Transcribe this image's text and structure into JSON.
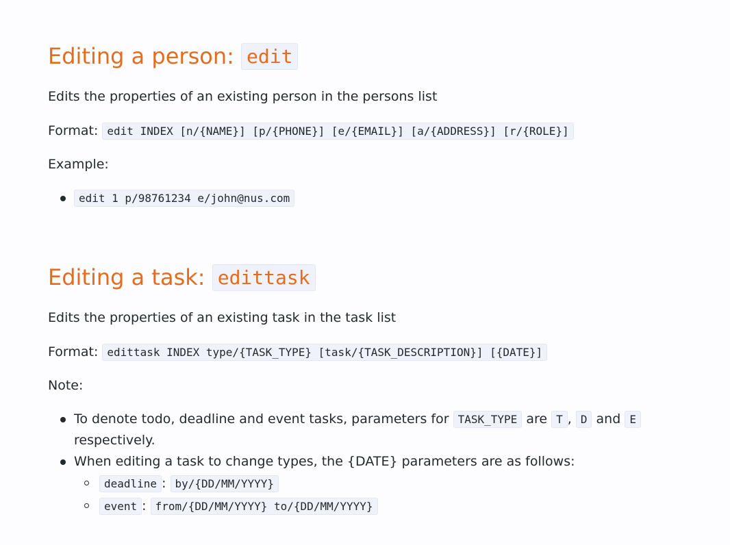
{
  "section_person": {
    "heading_text": "Editing a person: ",
    "heading_code": "edit",
    "description": "Edits the properties of an existing person in the persons list",
    "format_label": "Format: ",
    "format_code": "edit INDEX [n/{NAME}] [p/{PHONE}] [e/{EMAIL}] [a/{ADDRESS}] [r/{ROLE}]",
    "example_label": "Example:",
    "examples": [
      "edit 1 p/98761234 e/john@nus.com"
    ]
  },
  "section_task": {
    "heading_text": "Editing a task: ",
    "heading_code": "edittask",
    "description": "Edits the properties of an existing task in the task list",
    "format_label": "Format: ",
    "format_code": "edittask INDEX type/{TASK_TYPE} [task/{TASK_DESCRIPTION}] [{DATE}]",
    "note_label": "Note:",
    "note1": {
      "text1": "To denote todo, deadline and event tasks, parameters for ",
      "code1": "TASK_TYPE",
      "text2": " are ",
      "code2": "T",
      "text3": ", ",
      "code3": "D",
      "text4": " and ",
      "code4": "E",
      "text5": "respectively."
    },
    "note2": {
      "text": "When editing a task to change types, the {DATE} parameters are as follows:",
      "items": [
        {
          "type": "deadline",
          "sep": ": ",
          "value": "by/{DD/MM/YYYY}"
        },
        {
          "type": "event",
          "sep": ": ",
          "value": "from/{DD/MM/YYYY} to/{DD/MM/YYYY}"
        }
      ]
    }
  }
}
